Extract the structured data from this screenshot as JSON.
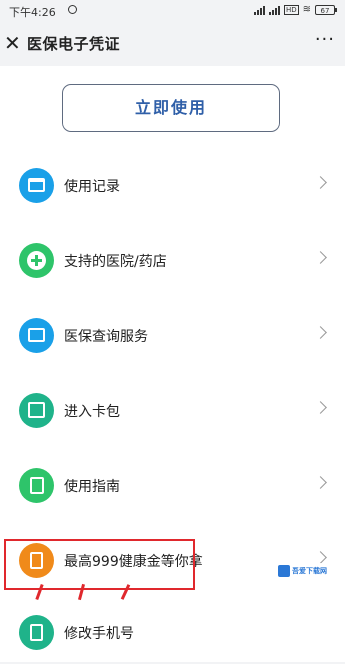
{
  "status_bar": {
    "time": "下午4:26",
    "battery": "67",
    "network_badge": "HD"
  },
  "header": {
    "title": "医保电子凭证",
    "close_icon": "close-icon",
    "more": "···"
  },
  "main": {
    "use_now_label": "立即使用",
    "items": [
      {
        "label": "使用记录",
        "icon": "card-icon",
        "color": "#1aa0e8"
      },
      {
        "label": "支持的医院/药店",
        "icon": "plus-icon",
        "color": "#2ec46a"
      },
      {
        "label": "医保查询服务",
        "icon": "id-card-icon",
        "color": "#1aa0e8"
      },
      {
        "label": "进入卡包",
        "icon": "wallet-icon",
        "color": "#1fb38a"
      },
      {
        "label": "使用指南",
        "icon": "document-icon",
        "color": "#2ec46a"
      },
      {
        "label": "最高999健康金等你拿",
        "icon": "red-envelope-icon",
        "color": "#f08a1a"
      },
      {
        "label": "修改手机号",
        "icon": "phone-icon",
        "color": "#1fb38a"
      }
    ]
  },
  "watermark": {
    "text": "吾爱下载网"
  }
}
